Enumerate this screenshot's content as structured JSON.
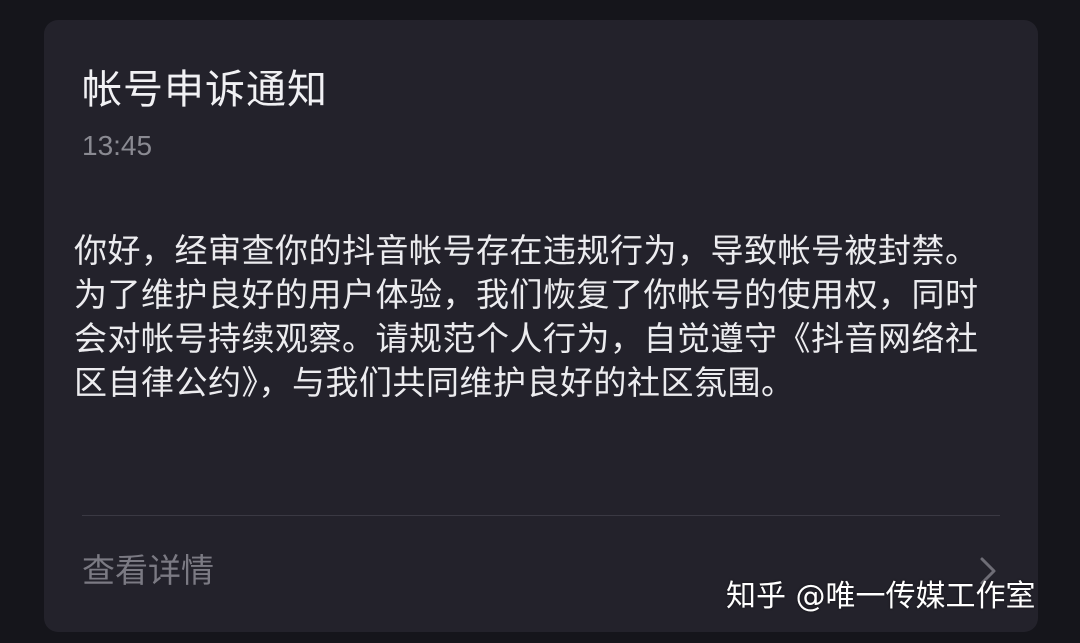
{
  "notification": {
    "title": "帐号申诉通知",
    "time": "13:45",
    "body": "你好，经审查你的抖音帐号存在违规行为，导致帐号被封禁。为了维护良好的用户体验，我们恢复了你帐号的使用权，同时会对帐号持续观察。请规范个人行为，自觉遵守《抖音网络社区自律公约》，与我们共同维护良好的社区氛围。",
    "detail_label": "查看详情",
    "detail_icon": "chevron-right-icon"
  },
  "watermark": {
    "text": "知乎 @唯一传媒工作室"
  },
  "colors": {
    "background": "#15151b",
    "card": "#23222b",
    "text_primary": "#ececef",
    "text_secondary": "#8a8a92"
  }
}
